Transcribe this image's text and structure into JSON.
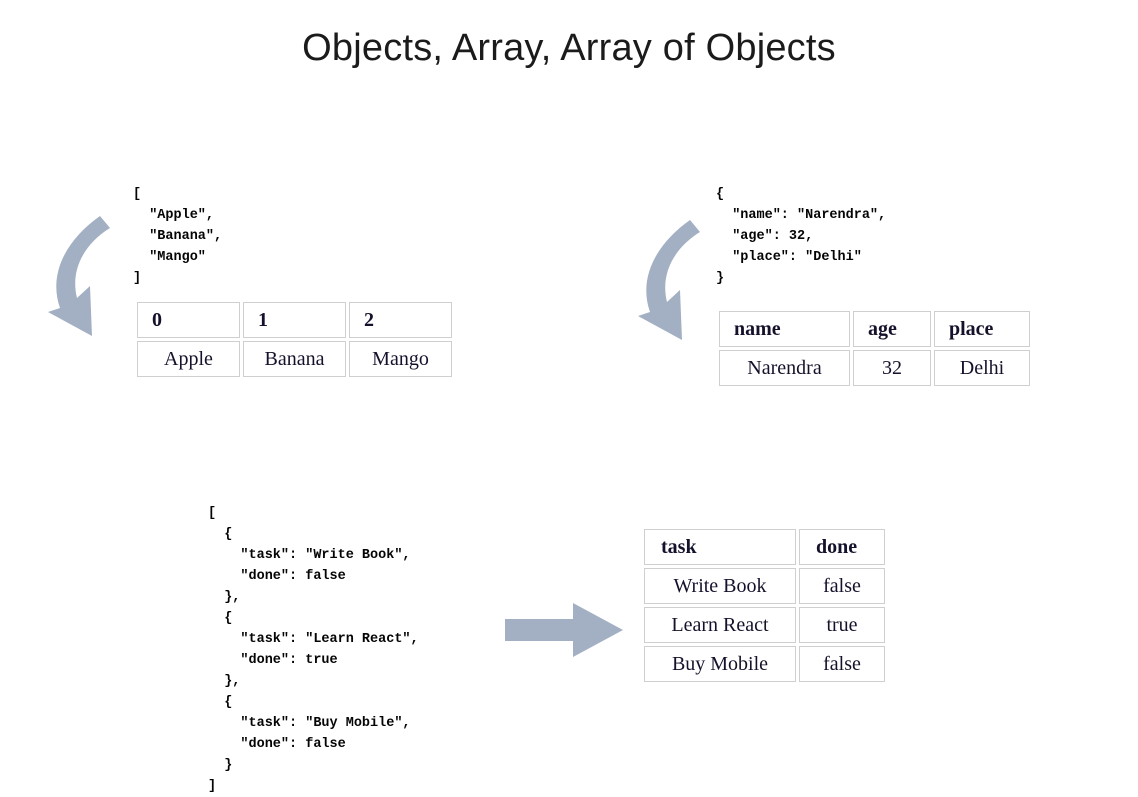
{
  "slide": {
    "title": "Objects, Array, Array of Objects",
    "background_color": "#ffffff",
    "arrow_color": "#a3b0c3",
    "table_border_color": "#cfcfcf"
  },
  "array_example": {
    "json": "[\n  \"Apple\",\n  \"Banana\",\n  \"Mango\"\n]",
    "table": {
      "headers": [
        "0",
        "1",
        "2"
      ],
      "rows": [
        [
          "Apple",
          "Banana",
          "Mango"
        ]
      ]
    }
  },
  "object_example": {
    "json": "{\n  \"name\": \"Narendra\",\n  \"age\": 32,\n  \"place\": \"Delhi\"\n}",
    "table": {
      "headers": [
        "name",
        "age",
        "place"
      ],
      "rows": [
        [
          "Narendra",
          "32",
          "Delhi"
        ]
      ]
    }
  },
  "array_of_objects_example": {
    "json": "[\n  {\n    \"task\": \"Write Book\",\n    \"done\": false\n  },\n  {\n    \"task\": \"Learn React\",\n    \"done\": true\n  },\n  {\n    \"task\": \"Buy Mobile\",\n    \"done\": false\n  }\n]",
    "table": {
      "headers": [
        "task",
        "done"
      ],
      "rows": [
        [
          "Write Book",
          "false"
        ],
        [
          "Learn React",
          "true"
        ],
        [
          "Buy Mobile",
          "false"
        ]
      ]
    }
  },
  "arrows": {
    "array_arrow": "curved-arrow-down-left-icon",
    "object_arrow": "curved-arrow-down-left-icon",
    "tasks_arrow": "straight-arrow-right-icon"
  }
}
